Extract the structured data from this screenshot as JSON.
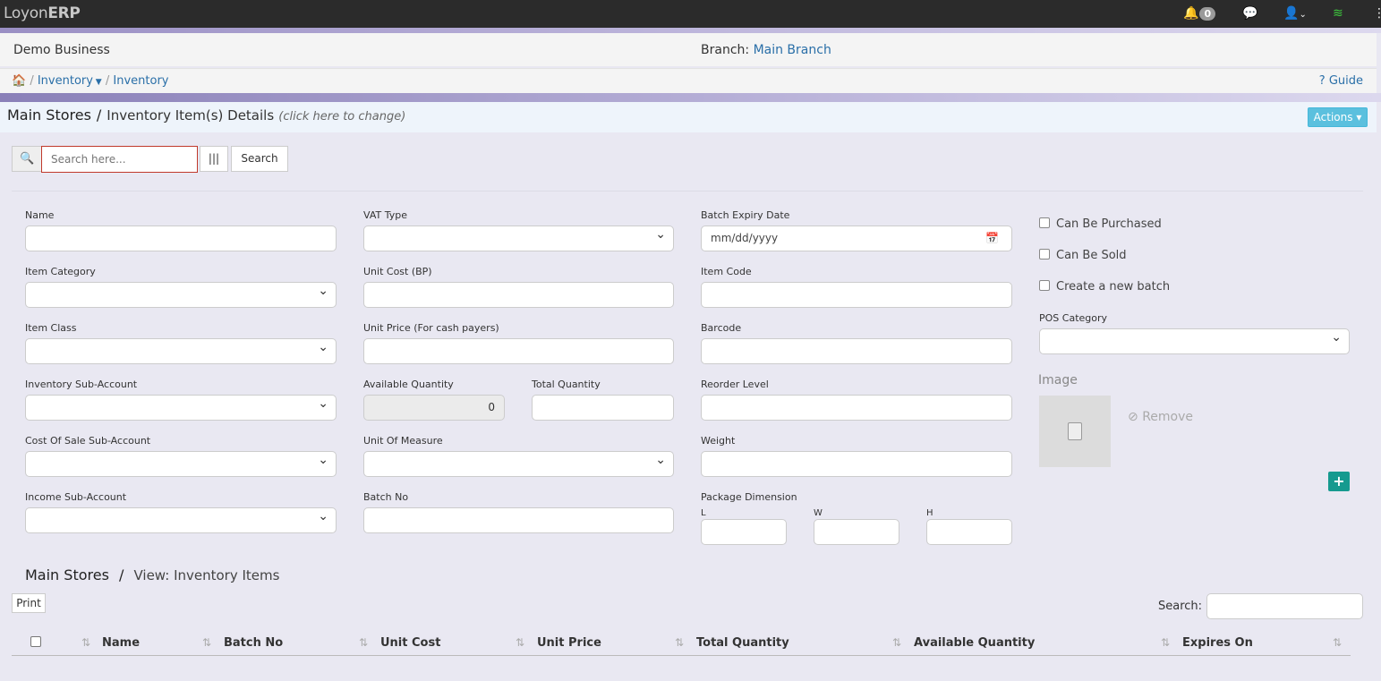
{
  "app": {
    "brand_light": "Loyon",
    "brand_bold": "ERP"
  },
  "topbar": {
    "notification_count": "0"
  },
  "business": {
    "name": "Demo Business",
    "branch_label": "Branch:",
    "branch_value": "Main Branch"
  },
  "breadcrumb": {
    "items": [
      "Inventory",
      "Inventory"
    ],
    "guide": "Guide"
  },
  "header": {
    "store": "Main Stores",
    "separator": "/",
    "title": "Inventory Item(s) Details",
    "hint": "(click here to change)",
    "actions": "Actions"
  },
  "search": {
    "placeholder": "Search here...",
    "button": "Search"
  },
  "form": {
    "name": "Name",
    "vat_type": "VAT Type",
    "batch_expiry": "Batch Expiry Date",
    "batch_expiry_placeholder": "mm/dd/yyyy",
    "item_category": "Item Category",
    "unit_cost": "Unit Cost (BP)",
    "item_code": "Item Code",
    "item_class": "Item Class",
    "unit_price": "Unit Price (For cash payers)",
    "barcode": "Barcode",
    "inventory_sub": "Inventory Sub-Account",
    "available_qty": "Available Quantity",
    "available_qty_value": "0",
    "total_qty": "Total Quantity",
    "reorder": "Reorder Level",
    "cost_of_sale": "Cost Of Sale Sub-Account",
    "unit_measure": "Unit Of Measure",
    "weight": "Weight",
    "income_sub": "Income Sub-Account",
    "batch_no": "Batch No",
    "package_dim": "Package Dimension",
    "dim_l": "L",
    "dim_w": "W",
    "dim_h": "H"
  },
  "side": {
    "can_purchased": "Can Be Purchased",
    "can_sold": "Can Be Sold",
    "new_batch": "Create a new batch",
    "pos_category": "POS Category",
    "image": "Image",
    "remove": "Remove"
  },
  "table_section": {
    "store": "Main Stores",
    "separator": "/",
    "title": "View: Inventory Items",
    "print": "Print",
    "search_label": "Search:",
    "columns": [
      "Name",
      "Batch No",
      "Unit Cost",
      "Unit Price",
      "Total Quantity",
      "Available Quantity",
      "Expires On"
    ]
  }
}
